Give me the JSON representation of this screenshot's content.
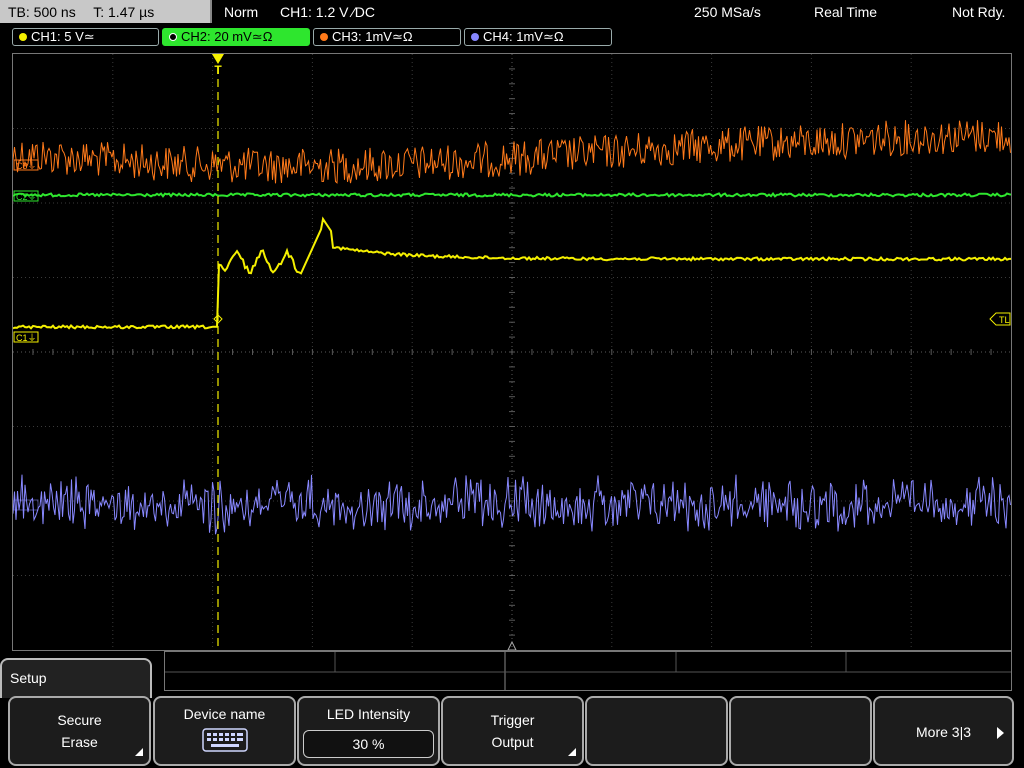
{
  "topbar": {
    "timebase": "TB: 500 ns",
    "trigger_time": "T: 1.47 µs",
    "mode": "Norm",
    "trigger_setting": "CH1: 1.2 V ∕DC",
    "sample_rate": "250 MSa/s",
    "acq_mode": "Real Time",
    "status": "Not Rdy."
  },
  "channels": [
    {
      "label": "CH1: 5 V≃",
      "color": "#f5f000"
    },
    {
      "label": "CH2: 20 mV≃Ω",
      "color": "#2ee62e"
    },
    {
      "label": "CH3: 1mV≃Ω",
      "color": "#ff7a1a"
    },
    {
      "label": "CH4: 1mV≃Ω",
      "color": "#8888ff"
    }
  ],
  "markers": {
    "trigger": "T",
    "ch1": "C1",
    "ch2": "C2",
    "ch3": "C3",
    "trigger_level": "TL"
  },
  "menu": {
    "title": "Setup",
    "softkeys": [
      {
        "line1": "Secure",
        "line2": "Erase"
      },
      {
        "line1": "Device name",
        "icon": "keyboard-icon"
      },
      {
        "line1": "LED Intensity",
        "value": "30 %"
      },
      {
        "line1": "Trigger",
        "line2": "Output"
      },
      {
        "line1": ""
      },
      {
        "line1": ""
      },
      {
        "line1": "More 3|3"
      }
    ]
  },
  "colors": {
    "ch1": "#f5f000",
    "ch2": "#2ee62e",
    "ch3": "#ff7a1a",
    "ch4": "#8888ff",
    "grid": "#3a3a3a",
    "active_tab": "#2ee62e"
  }
}
